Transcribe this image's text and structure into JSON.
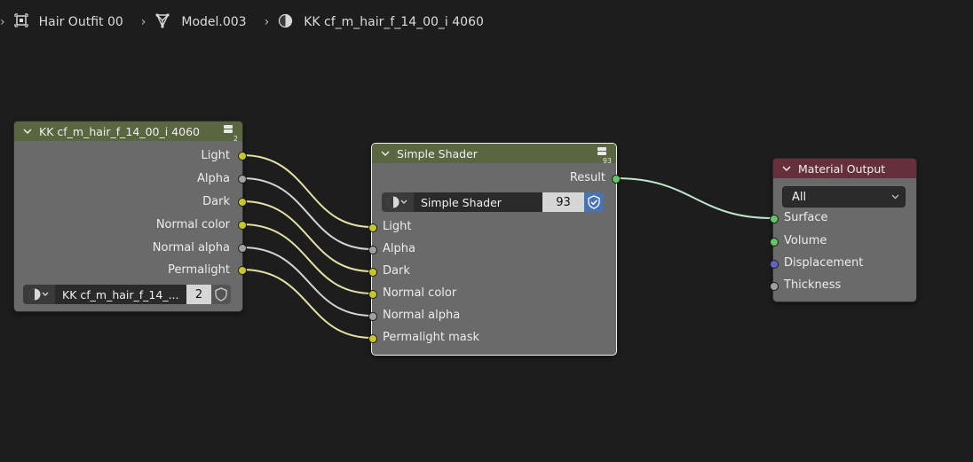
{
  "breadcrumb": {
    "collection_label": "Hair Outfit 00",
    "collection_icon": "object-icon",
    "mesh_label": "Model.003",
    "mesh_icon": "mesh-icon",
    "material_label": "KK cf_m_hair_f_14_00_i 4060",
    "material_icon": "material-icon"
  },
  "group_node": {
    "title": "KK cf_m_hair_f_14_00_i 4060",
    "user_count": "2",
    "header_color": "#596640",
    "outputs": [
      "Light",
      "Alpha",
      "Dark",
      "Normal color",
      "Normal alpha",
      "Permalight"
    ],
    "datablock": {
      "name": "KK cf_m_hair_f_14_...",
      "users": "2"
    }
  },
  "shader_node": {
    "title": "Simple Shader",
    "user_count": "93",
    "header_color": "#596640",
    "output": "Result",
    "datablock": {
      "name": "Simple Shader",
      "users": "93",
      "fake_user": true
    },
    "inputs": [
      "Light",
      "Alpha",
      "Dark",
      "Normal color",
      "Normal alpha",
      "Permalight mask"
    ]
  },
  "output_node": {
    "title": "Material Output",
    "header_color": "#652f3b",
    "target": "All",
    "inputs": [
      "Surface",
      "Volume",
      "Displacement",
      "Thickness"
    ]
  },
  "colors": {
    "background": "#1d1d1d",
    "node_body": "#6a6a6a",
    "socket_color": "#c7c729",
    "socket_float": "#a1a1a1",
    "socket_shader": "#63c763",
    "socket_vector": "#6363c7",
    "fake_user_active": "#4772b3"
  }
}
